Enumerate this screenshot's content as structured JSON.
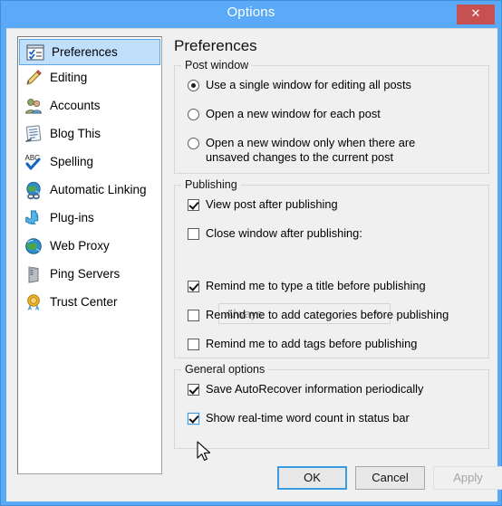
{
  "window": {
    "title": "Options",
    "close_label": "✕",
    "close_icon": "close-icon",
    "border_color": "#5aaaf7",
    "close_color": "#c75050"
  },
  "sidebar": {
    "items": [
      {
        "label": "Preferences",
        "icon": "preferences-icon",
        "selected": true
      },
      {
        "label": "Editing",
        "icon": "pencil-icon",
        "selected": false
      },
      {
        "label": "Accounts",
        "icon": "accounts-icon",
        "selected": false
      },
      {
        "label": "Blog This",
        "icon": "blog-this-icon",
        "selected": false
      },
      {
        "label": "Spelling",
        "icon": "spelling-abc-icon",
        "selected": false
      },
      {
        "label": "Automatic Linking",
        "icon": "globe-link-icon",
        "selected": false
      },
      {
        "label": "Plug-ins",
        "icon": "puzzle-piece-icon",
        "selected": false
      },
      {
        "label": "Web Proxy",
        "icon": "globe-icon",
        "selected": false
      },
      {
        "label": "Ping Servers",
        "icon": "server-icon",
        "selected": false
      },
      {
        "label": "Trust Center",
        "icon": "medal-icon",
        "selected": false
      }
    ]
  },
  "pane": {
    "title": "Preferences",
    "post_window": {
      "legend": "Post window",
      "radios": [
        {
          "label": "Use a single window for editing all posts",
          "checked": true
        },
        {
          "label": "Open a new window for each post",
          "checked": false
        },
        {
          "label": "Open a new window only when there are unsaved changes to the current post",
          "checked": false
        }
      ]
    },
    "publishing": {
      "legend": "Publishing",
      "checkboxes": [
        {
          "label": "View post after publishing",
          "checked": true,
          "hover": false
        },
        {
          "label": "Close window after publishing:",
          "checked": false,
          "hover": false
        },
        {
          "label": "Remind me to type a title before publishing",
          "checked": true,
          "hover": false
        },
        {
          "label": "Remind me to add categories before publishing",
          "checked": false,
          "hover": false
        },
        {
          "label": "Remind me to add tags before publishing",
          "checked": false,
          "hover": false
        }
      ],
      "combo": {
        "value": "Always",
        "enabled": false,
        "arrow_icon": "chevron-down-icon"
      }
    },
    "general_options": {
      "legend": "General options",
      "checkboxes": [
        {
          "label": "Save AutoRecover information periodically",
          "checked": true,
          "hover": false
        },
        {
          "label": "Show real-time word count in status bar",
          "checked": true,
          "hover": true
        }
      ]
    }
  },
  "buttons": {
    "ok": "OK",
    "cancel": "Cancel",
    "apply": "Apply",
    "apply_enabled": false
  }
}
